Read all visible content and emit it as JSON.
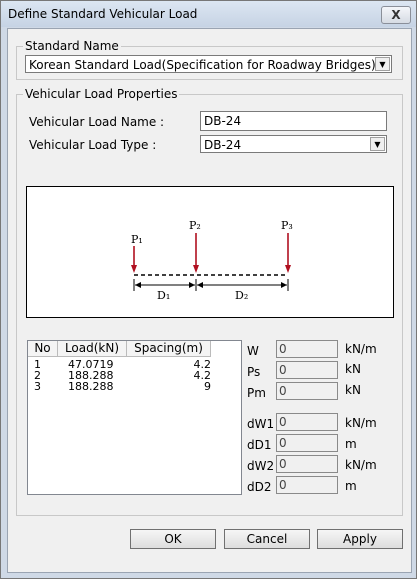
{
  "window": {
    "title": "Define Standard Vehicular Load",
    "close_label": "X"
  },
  "standard_name": {
    "legend": "Standard Name",
    "value": "Korean Standard Load(Specification for Roadway Bridges)"
  },
  "properties": {
    "legend": "Vehicular Load Properties",
    "name_label": "Vehicular Load Name :",
    "name_value": "DB-24",
    "type_label": "Vehicular Load Type :",
    "type_value": "DB-24"
  },
  "diagram": {
    "p1": "P₁",
    "p2": "P₂",
    "p3": "P₃",
    "d1": "D₁",
    "d2": "D₂"
  },
  "axle_table": {
    "columns": [
      "No",
      "Load(kN)",
      "Spacing(m)"
    ],
    "rows": [
      {
        "no": "1",
        "load": "47.0719",
        "spacing": "4.2"
      },
      {
        "no": "2",
        "load": "188.288",
        "spacing": "4.2"
      },
      {
        "no": "3",
        "load": "188.288",
        "spacing": "9"
      }
    ]
  },
  "fields": {
    "w": {
      "label": "W",
      "value": "0",
      "unit": "kN/m"
    },
    "ps": {
      "label": "Ps",
      "value": "0",
      "unit": "kN"
    },
    "pm": {
      "label": "Pm",
      "value": "0",
      "unit": "kN"
    },
    "dw1": {
      "label": "dW1",
      "value": "0",
      "unit": "kN/m"
    },
    "dd1": {
      "label": "dD1",
      "value": "0",
      "unit": "m"
    },
    "dw2": {
      "label": "dW2",
      "value": "0",
      "unit": "kN/m"
    },
    "dd2": {
      "label": "dD2",
      "value": "0",
      "unit": "m"
    }
  },
  "buttons": {
    "ok": "OK",
    "cancel": "Cancel",
    "apply": "Apply"
  },
  "colors": {
    "arrow": "#b01020",
    "window_frame": "#cfd9e6"
  }
}
